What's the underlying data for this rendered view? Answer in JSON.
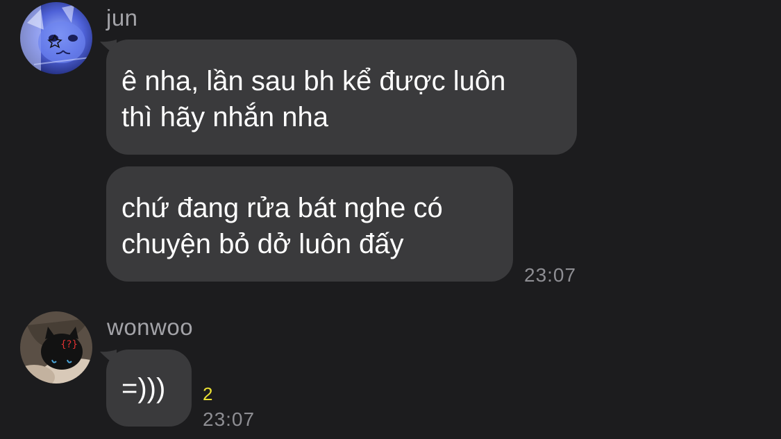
{
  "messages": [
    {
      "sender": "jun",
      "avatar_icon": "blue-cat-avatar-icon",
      "bubbles": [
        "ê nha, lần sau bh kể được luôn\nthì hãy nhắn nha",
        "chứ đang rửa bát nghe có\nchuyện bỏ dở luôn đấy"
      ],
      "time": "23:07"
    },
    {
      "sender": "wonwoo",
      "avatar_icon": "black-cat-avatar-icon",
      "bubbles": [
        "=)))"
      ],
      "unread_count": "2",
      "time": "23:07"
    }
  ],
  "colors": {
    "background": "#1c1c1e",
    "bubble": "#3a3a3c",
    "sender_name": "#a3a3a8",
    "timestamp": "#8e8e93",
    "unread_count": "#e9df33"
  }
}
